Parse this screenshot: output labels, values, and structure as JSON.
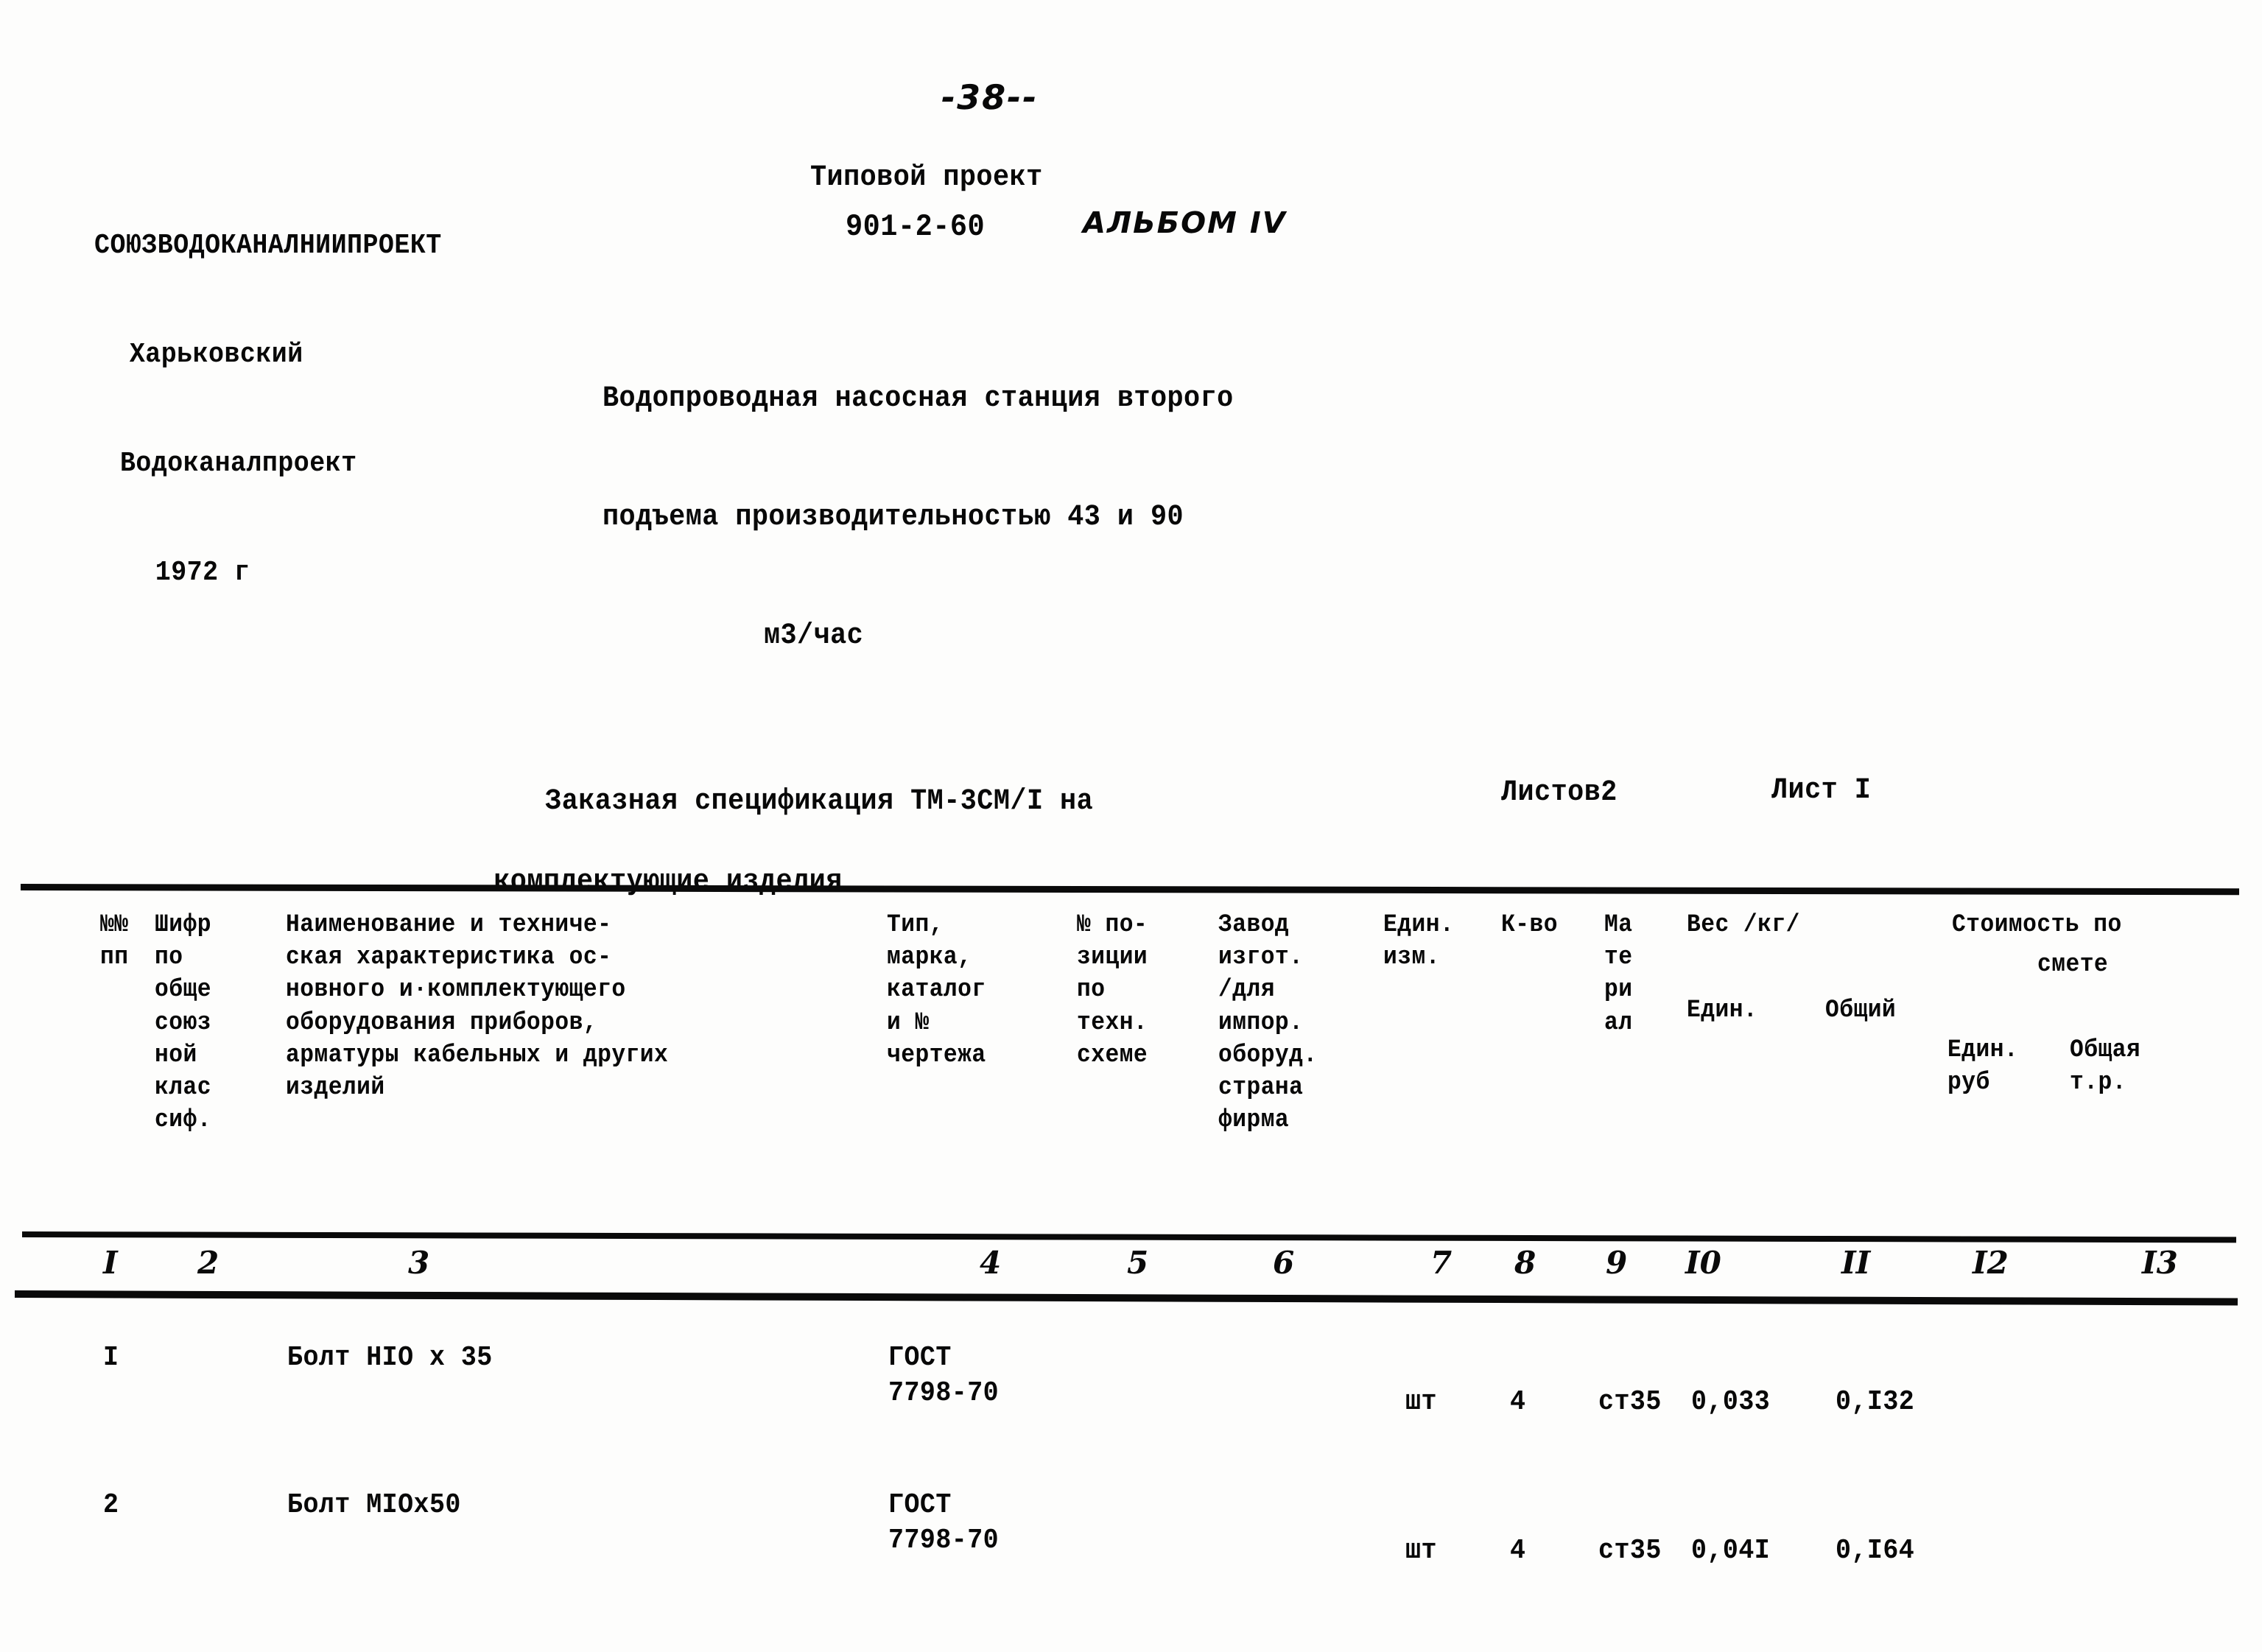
{
  "page": {
    "number": "-38--"
  },
  "organization": {
    "line1": "СОЮЗВОДОКАНАЛНИИПРОЕКТ",
    "line2": "Харьковский",
    "line3": "Водоканалпроект",
    "line4": "1972 г"
  },
  "project": {
    "label": "Типовой проект",
    "code": "901-2-60",
    "album_note": "АЛЬБОМ IV",
    "title_line1": "Водопроводная насосная станция второго",
    "title_line2": "подъема производительностью 43 и 90",
    "title_line3": "м3/час"
  },
  "specification": {
    "title_line1": "Заказная спецификация ТМ-3СМ/I на",
    "title_line2": "комплектующие изделия",
    "sheets_total": "Листов2",
    "sheet_current": "Лист I"
  },
  "table": {
    "headers": {
      "col1": "№№\nпп",
      "col2": "Шифр\nпо\nобще\nсоюз\nной\nклас\nсиф.",
      "col3": "Наименование и техниче-\nская характеристика ос-\nновного и·комплектующего\nоборудования приборов,\nарматуры кабельных и других\n       изделий",
      "col4": "Тип,\nмарка,\nкаталог\nи №\nчертежа",
      "col5": "№ по-\nзиции\nпо\nтехн.\nсхеме",
      "col6": "Завод\nизгот.\n/для\nимпор.\nоборуд.\nстрана\nфирма",
      "col7": "Един.\nизм.",
      "col8": "К-во",
      "col9": "Ма\nте\nри\nал",
      "col10": "Вес /кг/",
      "col10_sub1": "Един.",
      "col10_sub2": "Общий",
      "col11_line1": "Стоимость по",
      "col11_line2": "смете",
      "col11_sub1": "Един.\nруб",
      "col11_sub2": "Общая\nт.р."
    },
    "column_numbers": [
      "I",
      "2",
      "3",
      "4",
      "5",
      "6",
      "7",
      "8",
      "9",
      "I0",
      "II",
      "I2",
      "I3"
    ],
    "rows": [
      {
        "no": "I",
        "name": "Болт НIO x 35",
        "type_line1": "ГОСТ",
        "type_line2": "7798-70",
        "position": "",
        "manufacturer": "",
        "unit": "шт",
        "qty": "4",
        "material": "ст35",
        "weight_unit": "0,033",
        "weight_total": "0,I32",
        "cost_unit": "",
        "cost_total": ""
      },
      {
        "no": "2",
        "name": "Болт МIOx50",
        "type_line1": "ГОСТ",
        "type_line2": "7798-70",
        "position": "",
        "manufacturer": "",
        "unit": "шт",
        "qty": "4",
        "material": "ст35",
        "weight_unit": "0,04I",
        "weight_total": "0,I64",
        "cost_unit": "",
        "cost_total": ""
      }
    ]
  },
  "colors": {
    "ink": "#0a0a0a",
    "paper": "#fdfdfc"
  }
}
